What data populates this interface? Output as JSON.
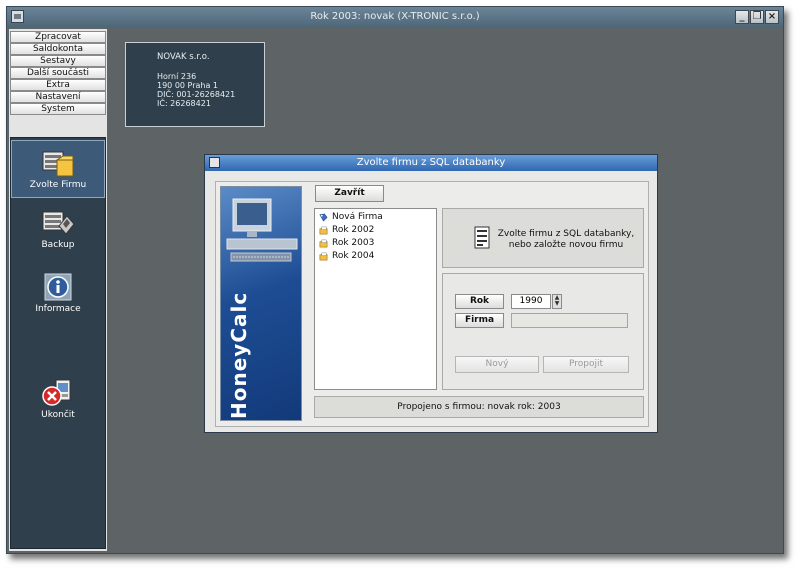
{
  "window": {
    "title": "Rok 2003: novak (X-TRONIC s.r.o.)",
    "buttons": [
      "_",
      "❐",
      "×"
    ]
  },
  "menu": {
    "items": [
      "Zpracovat",
      "Saldokonta",
      "Sestavy",
      "Další součásti",
      "Extra",
      "Nastavení",
      "System"
    ]
  },
  "nav": {
    "items": [
      {
        "label": "Zvolte Firmu",
        "icon": "company-folder-icon"
      },
      {
        "label": "Backup",
        "icon": "backup-disk-icon"
      },
      {
        "label": "Informace",
        "icon": "info-icon"
      },
      {
        "label": "Ukončit",
        "icon": "exit-icon"
      }
    ]
  },
  "infobox": {
    "company": "NOVAK s.r.o.",
    "lines": [
      "Horní 236",
      "190 00  Praha 1",
      "DIČ: 001-26268421",
      "IČ: 26268421"
    ]
  },
  "dialog": {
    "title": "Zvolte firmu z SQL databanky",
    "close_label": "Zavřít",
    "banner_text": "HoneyCalc",
    "tree": [
      {
        "label": "Nová Firma",
        "icon": "new-company-icon"
      },
      {
        "label": "Rok 2002",
        "icon": "year-folder-icon"
      },
      {
        "label": "Rok 2003",
        "icon": "year-folder-icon"
      },
      {
        "label": "Rok 2004",
        "icon": "year-folder-icon"
      }
    ],
    "hint": "Zvolte firmu z SQL databanky, nebo založte novou firmu",
    "rok_label": "Rok",
    "rok_value": "1990",
    "firma_label": "Firma",
    "firma_value": "",
    "novy_label": "Nový",
    "propojit_label": "Propojit",
    "status": "Propojeno s firmou:  novak   rok:  2003"
  },
  "colors": {
    "desktop": "#5e6366",
    "nav_panel": "#2f3f4b",
    "dialog_title": "#2f68b1"
  }
}
